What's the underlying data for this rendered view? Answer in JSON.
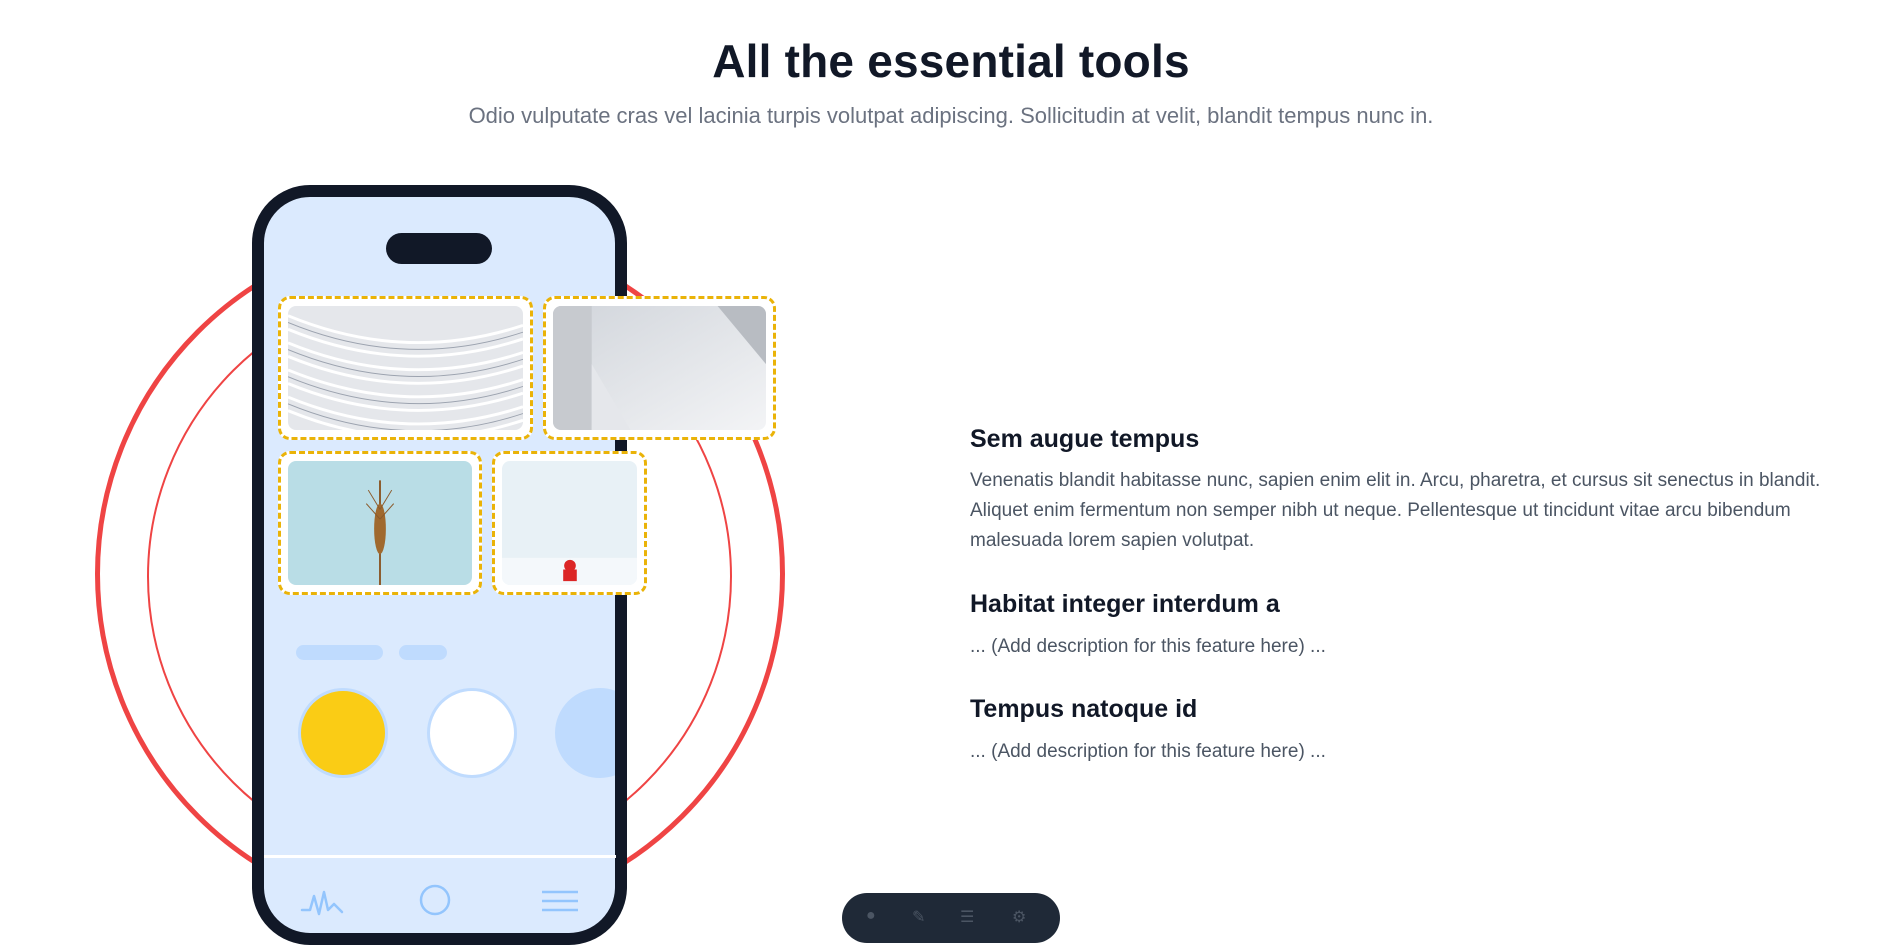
{
  "header": {
    "title": "All the essential tools",
    "subtitle": "Odio vulputate cras vel lacinia turpis volutpat adipiscing. Sollicitudin at velit, blandit tempus nunc in."
  },
  "features": [
    {
      "title": "Sem augue tempus",
      "description": "Venenatis blandit habitasse nunc, sapien enim elit in. Arcu, pharetra, et cursus sit senectus in blandit. Aliquet enim fermentum non semper nibh ut neque. Pellentesque ut tincidunt vitae arcu bibendum malesuada lorem sapien volutpat."
    },
    {
      "title": "Habitat integer interdum a",
      "description": "... (Add description for this feature here) ..."
    },
    {
      "title": "Tempus natoque id",
      "description": "... (Add description for this feature here) ..."
    }
  ],
  "illustration": {
    "photos": [
      "abstract-white-architecture",
      "grey-geometric-wall",
      "dried-wheat-stalk",
      "red-figure-on-snow"
    ],
    "nav_icons": [
      "activity-icon",
      "search-icon",
      "menu-icon"
    ]
  },
  "colors": {
    "ring": "#ef4444",
    "phone_frame": "#111827",
    "phone_screen": "#dbeafe",
    "photo_border": "#eab308",
    "yellow_circle": "#facc15",
    "blue_circle": "#bfdbfe"
  }
}
